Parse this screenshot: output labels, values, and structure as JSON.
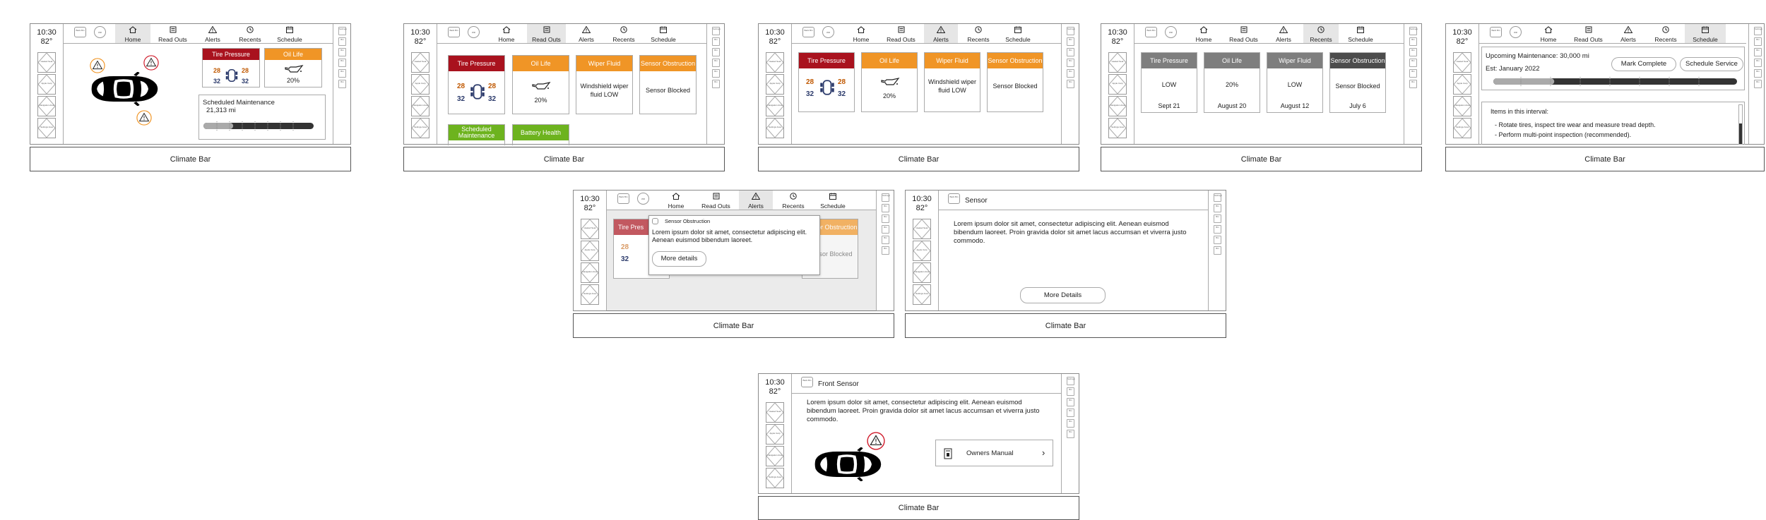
{
  "common": {
    "time": "10:30",
    "temp": "82°",
    "climate_bar": "Climate Bar",
    "tabs": [
      "Home",
      "Read Outs",
      "Alerts",
      "Recents",
      "Schedule"
    ],
    "left_buttons": [
      "Heated Seat",
      "Apple Carp",
      "Navigation Area",
      "Settings Area"
    ],
    "top_buttons": [
      "Back Btn",
      "Wifi"
    ],
    "right_buttons": [
      "Settings",
      "Btn",
      "Btn",
      "Btn",
      "Btn",
      "Btn"
    ]
  },
  "s1_home": {
    "tire_title": "Tire Pressure",
    "tire_values": [
      "28",
      "28",
      "32",
      "32"
    ],
    "oil_title": "Oil Life",
    "oil_value": "20%",
    "maint_title": "Scheduled Maintenance",
    "maint_miles": "21,313 mi",
    "maint_progress": 0.27
  },
  "s2_readouts": {
    "tire_title": "Tire Pressure",
    "tire_values": [
      "28",
      "28",
      "32",
      "32"
    ],
    "oil_title": "Oil Life",
    "oil_value": "20%",
    "wiper_title": "Wiper Fluid",
    "wiper_value": "Windshield wiper fluid LOW",
    "sensor_title": "Sensor Obstruction",
    "sensor_value": "Sensor Blocked",
    "maint_title": "Scheduled Maintenance",
    "battery_title": "Battery Health"
  },
  "s3_alerts": {
    "tire_title": "Tire Pressure",
    "tire_values": [
      "28",
      "28",
      "32",
      "32"
    ],
    "oil_title": "Oil Life",
    "oil_value": "20%",
    "wiper_title": "Wiper Fluid",
    "wiper_value": "Windshield wiper fluid LOW",
    "sensor_title": "Sensor Obstruction",
    "sensor_value": "Sensor Blocked"
  },
  "s4_recents": {
    "cards": [
      {
        "title": "Tire Pressure",
        "value": "LOW",
        "date": "Sept 21"
      },
      {
        "title": "Oil Life",
        "value": "20%",
        "date": "August 20"
      },
      {
        "title": "Wiper Fluid",
        "value": "LOW",
        "date": "August 12"
      },
      {
        "title": "Sensor Obstruction",
        "value": "Sensor Blocked",
        "date": "July 6"
      }
    ]
  },
  "s5_schedule": {
    "upcoming": "Upcoming Maintenance: 30,000 mi",
    "est": "Est: January 2022",
    "mark_complete": "Mark Complete",
    "schedule_service": "Schedule Service",
    "progress": 0.25,
    "items_title": "Items in this interval:",
    "items": [
      "- Rotate tires, inspect tire wear and measure tread depth.",
      "- Perform multi-point inspection (recommended)."
    ]
  },
  "s6_popup": {
    "tire_title": "Tire Pres",
    "sensor_title": "Sensor Obstruction",
    "sensor_value": "Sensor Blocked",
    "popup_title": "Sensor Obstruction",
    "popup_body": "Lorem ipsum dolor sit amet, consectetur adipiscing elit. Aenean euismod bibendum laoreet.",
    "more": "More details",
    "tire_values": [
      "28",
      "32"
    ]
  },
  "s7_sensor": {
    "title": "Sensor",
    "body": "Lorem ipsum dolor sit amet, consectetur adipiscing elit. Aenean euismod bibendum laoreet. Proin gravida dolor sit amet lacus accumsan et viverra justo commodo.",
    "more": "More Details"
  },
  "s8_front": {
    "title": "Front Sensor",
    "body": "Lorem ipsum dolor sit amet, consectetur adipiscing elit. Aenean euismod bibendum laoreet. Proin gravida dolor sit amet lacus accumsan et viverra justo commodo.",
    "manual": "Owners Manual"
  }
}
